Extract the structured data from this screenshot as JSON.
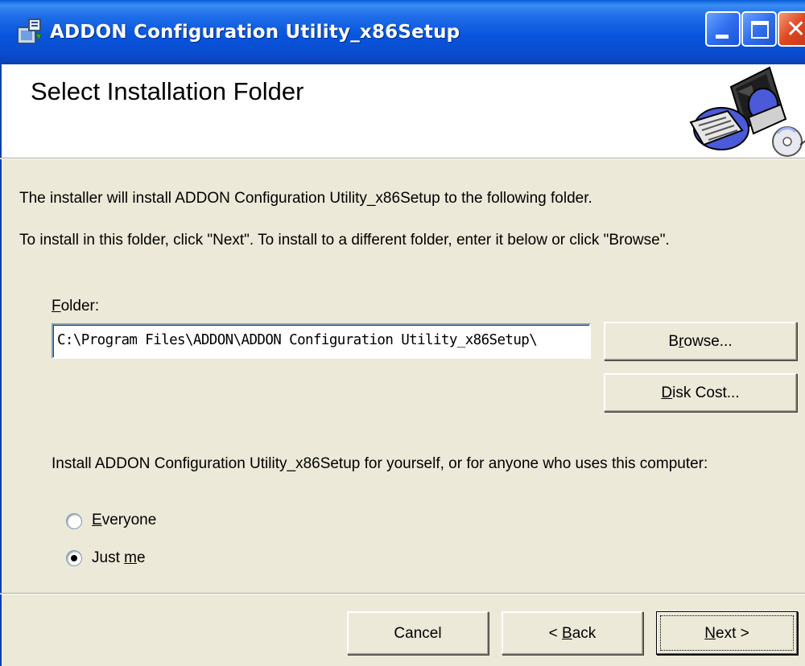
{
  "window": {
    "title": "ADDON Configuration Utility_x86Setup",
    "icon": "installer-icon",
    "accent_color": "#0a4ccf"
  },
  "banner": {
    "title": "Select Installation Folder",
    "image": "computer-setup-illustration"
  },
  "intro": {
    "line1": "The installer will install ADDON Configuration Utility_x86Setup to the following folder.",
    "line2": "To install in this folder, click \"Next\". To install to a different folder, enter it below or click \"Browse\"."
  },
  "folder": {
    "label_mnemonic": "F",
    "label_rest": "older:",
    "value": "C:\\Program Files\\ADDON\\ADDON Configuration Utility_x86Setup\\"
  },
  "buttons": {
    "browse_pre": "B",
    "browse_mnemonic": "r",
    "browse_post": "owse...",
    "diskcost_mnemonic": "D",
    "diskcost_post": "isk Cost...",
    "cancel": "Cancel",
    "back_pre": "< ",
    "back_mnemonic": "B",
    "back_post": "ack",
    "next_mnemonic": "N",
    "next_post": "ext >"
  },
  "install_for": {
    "question": "Install ADDON Configuration Utility_x86Setup for yourself, or for anyone who uses this computer:",
    "options": [
      {
        "mnemonic": "E",
        "rest": "veryone",
        "selected": false
      },
      {
        "pre": "Just ",
        "mnemonic": "m",
        "rest": "e",
        "selected": true
      }
    ]
  }
}
